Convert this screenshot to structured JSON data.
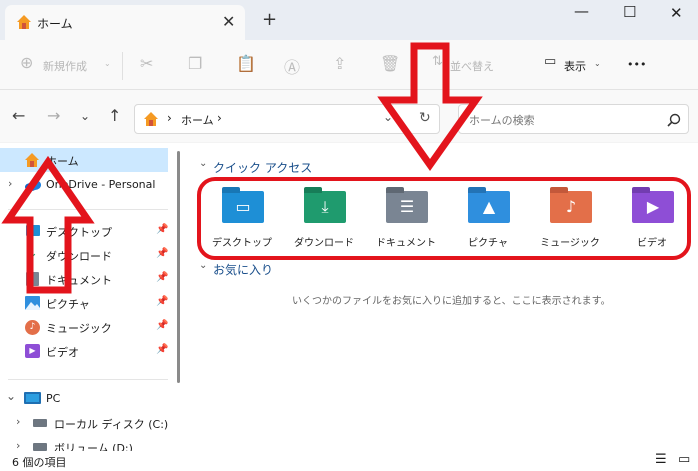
{
  "window": {
    "tab_title": "ホーム",
    "tab_close": "✕",
    "new_tab": "+",
    "minimize": "—",
    "maximize": "☐",
    "close": "✕"
  },
  "toolbar": {
    "new": "新規作成",
    "sort": "並べ替え",
    "view": "表示",
    "more": "•••"
  },
  "address": {
    "breadcrumb": "ホーム",
    "chevron": "›",
    "search_placeholder": "ホームの検索"
  },
  "nav": {
    "home": "ホーム",
    "onedrive": "OneDrive - Personal",
    "pinned": [
      "デスクトップ",
      "ダウンロード",
      "ドキュメント",
      "ピクチャ",
      "ミュージック",
      "ビデオ"
    ],
    "pc": "PC",
    "drives": [
      "ローカル ディスク (C:)",
      "ボリューム (D:)"
    ]
  },
  "main": {
    "quick_access": "クイック アクセス",
    "favorites": "お気に入り",
    "favorites_empty": "いくつかのファイルをお気に入りに追加すると、ここに表示されます。",
    "folders": [
      {
        "label": "デスクトップ",
        "color": "#1e8fd6"
      },
      {
        "label": "ダウンロード",
        "color": "#1f9b6e"
      },
      {
        "label": "ドキュメント",
        "color": "#7a8593"
      },
      {
        "label": "ピクチャ",
        "color": "#2f8fde"
      },
      {
        "label": "ミュージック",
        "color": "#e36f49"
      },
      {
        "label": "ビデオ",
        "color": "#8e4ed6"
      }
    ]
  },
  "status": {
    "count": "6 個の項目"
  },
  "colors": {
    "annotation": "#e3141c",
    "selection": "#cce8ff",
    "accent": "#0067c0"
  }
}
